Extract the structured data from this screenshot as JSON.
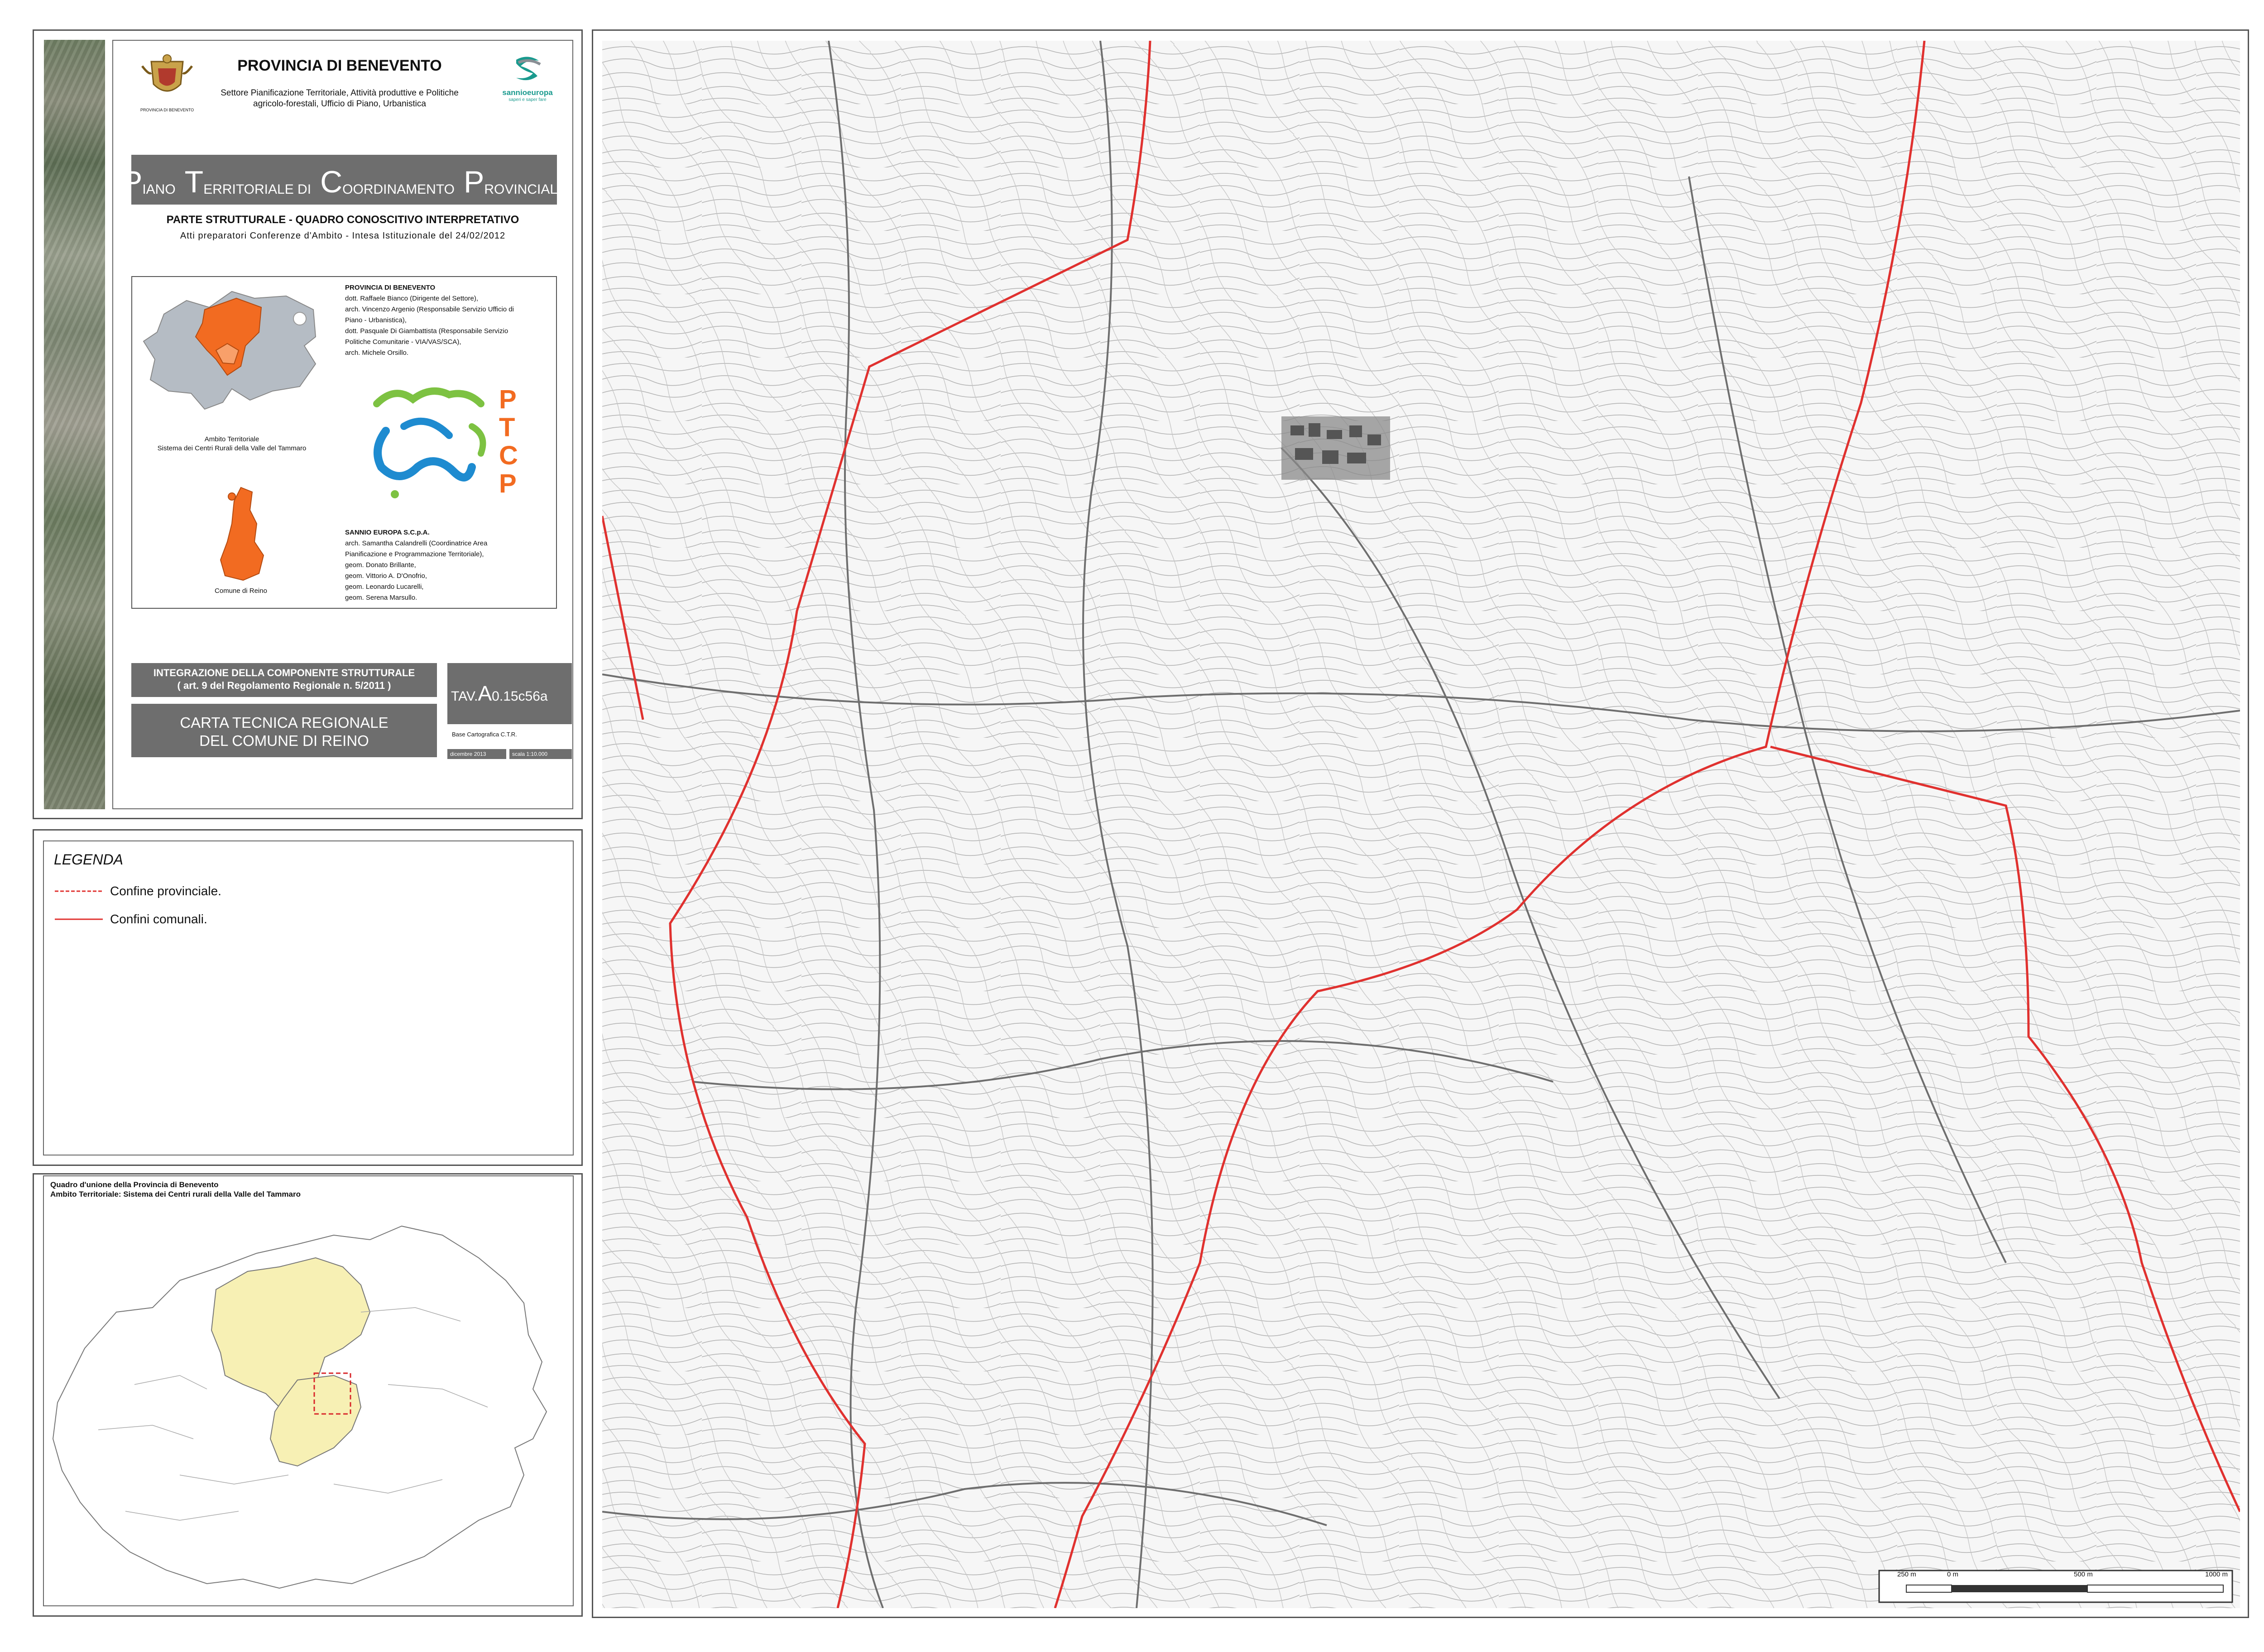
{
  "header": {
    "org_title": "PROVINCIA DI BENEVENTO",
    "org_subtitle_1": "Settore Pianificazione Territoriale, Attività produttive e Politiche",
    "org_subtitle_2": "agricolo-forestali, Ufficio di Piano, Urbanistica",
    "crest_caption": "PROVINCIA DI BENEVENTO",
    "sannio_logo_text": "sannioeuropa",
    "sannio_logo_tagline": "saperi e saper fare"
  },
  "plan": {
    "title_caps": [
      "P",
      "T",
      "C",
      "P"
    ],
    "title_words": [
      "IANO",
      "ERRITORIALE DI",
      "OORDINAMENTO",
      "ROVINCIALE"
    ],
    "section": "PARTE STRUTTURALE - QUADRO CONOSCITIVO INTERPRETATIVO",
    "subtitle": "Atti preparatori Conferenze d'Ambito - Intesa Istituzionale del 24/02/2012"
  },
  "credits": {
    "ambito_label": "Ambito Territoriale",
    "ambito_name": "Sistema dei Centri Rurali della Valle del Tammaro",
    "comune_label": "Comune di Reino",
    "provincia_heading": "PROVINCIA DI BENEVENTO",
    "provincia_staff": [
      "dott. Raffaele Bianco (Dirigente del Settore),",
      "arch. Vincenzo Argenio (Responsabile Servizio Ufficio di",
      "Piano - Urbanistica),",
      "dott. Pasquale Di Giambattista (Responsabile Servizio",
      "Politiche Comunitarie - VIA/VAS/SCA),",
      "arch. Michele Orsillo."
    ],
    "ptcp_letters": [
      "P",
      "T",
      "C",
      "P"
    ],
    "sannio_heading": "SANNIO EUROPA S.C.p.A.",
    "sannio_staff": [
      "arch. Samantha Calandrelli (Coordinatrice Area",
      "Pianificazione e Programmazione Territoriale),",
      "geom. Donato Brillante,",
      "geom. Vittorio A. D'Onofrio,",
      "geom. Leonardo Lucarelli,",
      "geom. Serena Marsullo."
    ]
  },
  "sheet": {
    "integration_line1": "INTEGRAZIONE DELLA COMPONENTE STRUTTURALE",
    "integration_line2": "( art. 9 del Regolamento Regionale n. 5/2011 )",
    "carta_line1": "CARTA TECNICA REGIONALE",
    "carta_line2": "DEL COMUNE DI REINO",
    "tav_prefix": "TAV.",
    "tav_letter": "A",
    "tav_code": "0.15c56a",
    "base_text": "Base Cartografica C.T.R.",
    "date_text": "dicembre 2013",
    "scale_text": "scala 1:10.000"
  },
  "legend": {
    "title": "LEGENDA",
    "items": [
      {
        "label": "Confine provinciale.",
        "color": "#e0312f",
        "style": "dashed"
      },
      {
        "label": "Confini comunali.",
        "color": "#e0312f",
        "style": "solid"
      }
    ]
  },
  "overview": {
    "title_line1": "Quadro d'unione della Provincia di Benevento",
    "title_line2": "Ambito Territoriale: Sistema dei Centri rurali della Valle del Tammaro",
    "ambito_color": "#f7f0b4",
    "highlight_color": "#d8262a"
  },
  "map": {
    "boundary_color": "#e0312f",
    "scale_bar": {
      "labels": [
        "250 m",
        "0 m",
        "500 m",
        "1000 m"
      ]
    }
  },
  "colors": {
    "accent_orange": "#f26b21",
    "ambito_grey": "#b5bcc4",
    "ptcp_green": "#7dc242",
    "ptcp_blue": "#1e8bd0",
    "banner_grey": "#6e6e6e"
  }
}
